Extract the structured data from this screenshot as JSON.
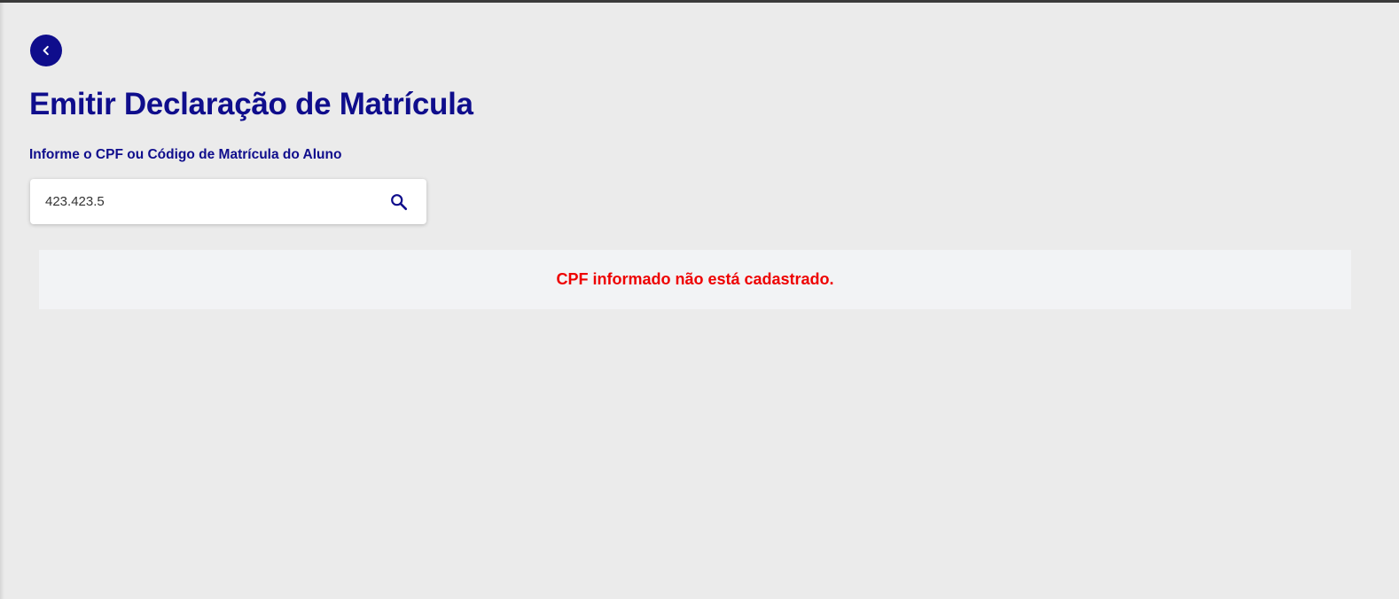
{
  "colors": {
    "brand": "#0f0d8c",
    "background": "#ebebeb",
    "panel": "#f2f3f5",
    "error": "#ee0000"
  },
  "header": {
    "back_icon": "chevron-left-icon",
    "title": "Emitir Declaração de Matrícula"
  },
  "form": {
    "label": "Informe o CPF ou Código de Matrícula do Aluno",
    "input_value": "423.423.5",
    "search_icon": "search-icon"
  },
  "message": {
    "error": "CPF informado não está cadastrado."
  }
}
